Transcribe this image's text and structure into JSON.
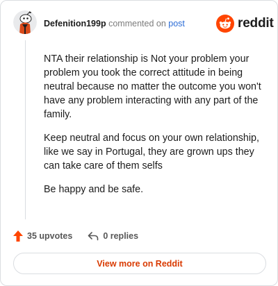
{
  "header": {
    "username": "Defenition199p",
    "action_text": "commented on",
    "post_link": "post",
    "brand_name": "reddit",
    "brand_color": "#ff4500"
  },
  "comment": {
    "paragraphs": [
      "NTA their relationship is Not your problem your problem you took the correct attitude in being neutral because no matter the outcome you won't have any problem interacting with any part of the family.",
      "Keep neutral and focus on your own relationship, like we say in Portugal, they are grown ups they can take care of them selfs",
      "Be happy and be safe."
    ]
  },
  "actions": {
    "upvotes_label": "35 upvotes",
    "replies_label": "0 replies",
    "upvote_color": "#ff4500"
  },
  "footer": {
    "view_more_label": "View more on Reddit",
    "link_color": "#d93a00"
  },
  "icons": [
    "reddit-avatar-icon",
    "reddit-logo-icon",
    "upvote-arrow-icon",
    "reply-arrow-icon"
  ]
}
